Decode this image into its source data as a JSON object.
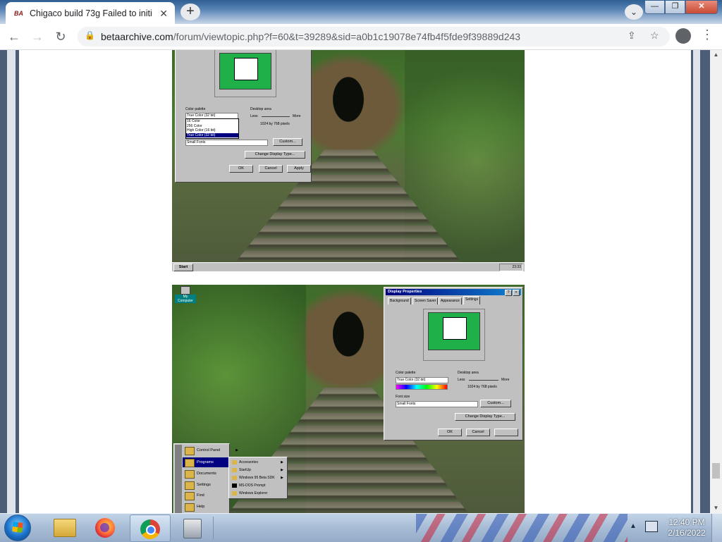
{
  "browser": {
    "tab_title": "Chigaco build 73g Failed to initi",
    "tab_favicon": "BA",
    "new_tab": "+",
    "close_tab": "✕",
    "url_domain": "betaarchive.com",
    "url_path": "/forum/viewtopic.php?f=60&t=39289&sid=a0b1c19078e74fb4f5fde9f39889d243",
    "window_buttons": {
      "minimize": "—",
      "maximize": "❐",
      "close": "✕"
    }
  },
  "screenshot1": {
    "color_palette_label": "Color palette",
    "color_palette_value": "True Color (32 bit)",
    "palette_options": [
      "16 Color",
      "256 Color",
      "High Color (16 bit)",
      "True Color (32 bit)"
    ],
    "palette_selected_index": 3,
    "desktop_area_label": "Desktop area",
    "less": "Less",
    "more": "More",
    "resolution": "1024 by 768 pixels",
    "font_size_value": "Small Fonts",
    "custom_button": "Custom...",
    "change_display_button": "Change Display Type...",
    "ok": "OK",
    "cancel": "Cancel",
    "apply": "Apply",
    "start": "Start",
    "clock": "23:33"
  },
  "screenshot2": {
    "desktop_icon": "My Computer",
    "dialog_title": "Display Properties",
    "tabs": [
      "Background",
      "Screen Saver",
      "Appearance",
      "Settings"
    ],
    "color_palette_label": "Color palette",
    "color_palette_value": "True Color (32 bit)",
    "desktop_area_label": "Desktop area",
    "less": "Less",
    "more": "More",
    "resolution": "1024 by 768 pixels",
    "font_size_label": "Font size",
    "font_size_value": "Small Fonts",
    "custom_button": "Custom...",
    "change_display_button": "Change Display Type...",
    "ok": "OK",
    "cancel": "Cancel",
    "start_menu": [
      "Control Panel",
      "Programs",
      "Documents",
      "Settings",
      "Find",
      "Help"
    ],
    "programs_submenu": [
      "Accessories",
      "StartUp",
      "Windows 95 Beta SDK",
      "MS-DOS Prompt",
      "Windows Explorer"
    ]
  },
  "taskbar": {
    "time": "12:40 PM",
    "date": "2/16/2022",
    "apps": [
      "file-explorer",
      "firefox",
      "chrome",
      "virtual-machine"
    ]
  }
}
